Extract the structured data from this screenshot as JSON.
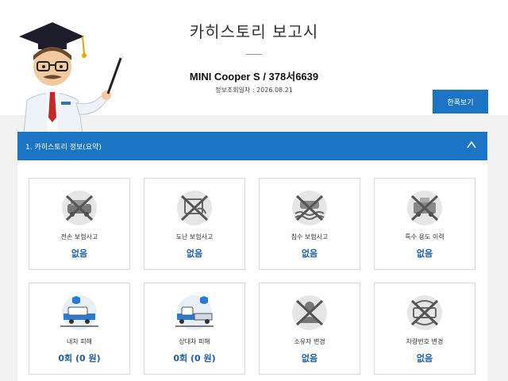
{
  "header": {
    "title": "카히스토리 보고시",
    "vehicle": "MINI Cooper S / 378서6639",
    "query_date": "정보조회일자 : 2026.08.21",
    "brief_button": "한폭보기"
  },
  "section": {
    "title": "1. 카히스토리 정보(요약)",
    "collapse_icon": "chevron-up-icon"
  },
  "cards": [
    {
      "label": "전손 보험사고",
      "value": "없음",
      "icon": "total-loss-icon"
    },
    {
      "label": "도난 보험사고",
      "value": "없음",
      "icon": "theft-icon"
    },
    {
      "label": "침수 보험사고",
      "value": "없음",
      "icon": "flood-icon"
    },
    {
      "label": "특수 용도 이력",
      "value": "없음",
      "icon": "special-use-icon"
    },
    {
      "label": "내차 피해",
      "value": "0회 (0 원)",
      "icon": "own-damage-icon"
    },
    {
      "label": "상대차 피해",
      "value": "0회 (0 원)",
      "icon": "other-damage-icon"
    },
    {
      "label": "소유자 변경",
      "value": "없음",
      "icon": "owner-change-icon"
    },
    {
      "label": "차량번호 변경",
      "value": "없음",
      "icon": "plate-change-icon"
    }
  ],
  "colors": {
    "accent": "#1c74c4",
    "value_text": "#1c5fa8"
  }
}
